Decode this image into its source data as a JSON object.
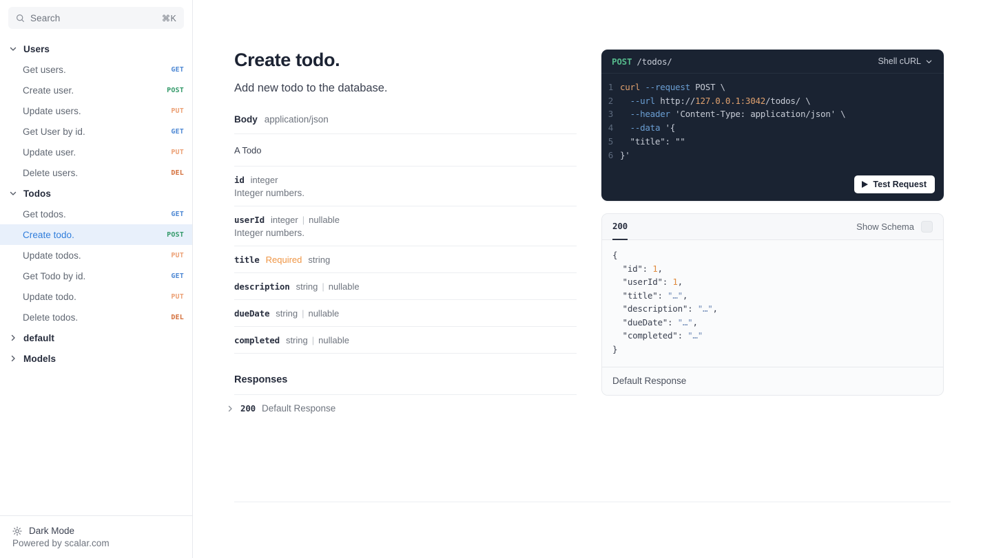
{
  "sidebar": {
    "search": {
      "placeholder": "Search",
      "shortcut": "⌘K",
      "icon": "search-icon"
    },
    "groups": [
      {
        "label": "Users",
        "expanded": true,
        "chevron": "chevron-down-icon",
        "items": [
          {
            "label": "Get users.",
            "method": "GET",
            "method_class": "m-get"
          },
          {
            "label": "Create user.",
            "method": "POST",
            "method_class": "m-post"
          },
          {
            "label": "Update users.",
            "method": "PUT",
            "method_class": "m-put"
          },
          {
            "label": "Get User by id.",
            "method": "GET",
            "method_class": "m-get"
          },
          {
            "label": "Update user.",
            "method": "PUT",
            "method_class": "m-put"
          },
          {
            "label": "Delete users.",
            "method": "DEL",
            "method_class": "m-del"
          }
        ]
      },
      {
        "label": "Todos",
        "expanded": true,
        "chevron": "chevron-down-icon",
        "items": [
          {
            "label": "Get todos.",
            "method": "GET",
            "method_class": "m-get",
            "active": false
          },
          {
            "label": "Create todo.",
            "method": "POST",
            "method_class": "m-post",
            "active": true
          },
          {
            "label": "Update todos.",
            "method": "PUT",
            "method_class": "m-put",
            "active": false
          },
          {
            "label": "Get Todo by id.",
            "method": "GET",
            "method_class": "m-get",
            "active": false
          },
          {
            "label": "Update todo.",
            "method": "PUT",
            "method_class": "m-put",
            "active": false
          },
          {
            "label": "Delete todos.",
            "method": "DEL",
            "method_class": "m-del",
            "active": false
          }
        ]
      },
      {
        "label": "default",
        "expanded": false,
        "chevron": "chevron-right-icon",
        "items": []
      },
      {
        "label": "Models",
        "expanded": false,
        "chevron": "chevron-right-icon",
        "items": []
      }
    ],
    "footer": {
      "dark_mode_label": "Dark Mode",
      "dark_mode_icon": "sun-icon",
      "powered_by": "Powered by scalar.com"
    }
  },
  "main": {
    "title": "Create todo.",
    "description": "Add new todo to the database.",
    "body": {
      "label": "Body",
      "mime": "application/json",
      "schema_title": "A Todo",
      "properties": [
        {
          "name": "id",
          "required": "",
          "type": "integer",
          "nullable": "",
          "description": "Integer numbers."
        },
        {
          "name": "userId",
          "required": "",
          "type": "integer",
          "nullable": "nullable",
          "description": "Integer numbers."
        },
        {
          "name": "title",
          "required": "Required",
          "type": "string",
          "nullable": "",
          "description": ""
        },
        {
          "name": "description",
          "required": "",
          "type": "string",
          "nullable": "nullable",
          "description": ""
        },
        {
          "name": "dueDate",
          "required": "",
          "type": "string",
          "nullable": "nullable",
          "description": ""
        },
        {
          "name": "completed",
          "required": "",
          "type": "string",
          "nullable": "nullable",
          "description": ""
        }
      ]
    },
    "responses": {
      "section_title": "Responses",
      "rows": [
        {
          "code": "200",
          "text": "Default Response",
          "chevron": "chevron-right-icon"
        }
      ]
    }
  },
  "code_panel": {
    "method": "POST",
    "path": "/todos/",
    "language": "Shell cURL",
    "language_chevron": "chevron-down-icon",
    "lines": [
      {
        "num": "1",
        "tokens": [
          {
            "t": "curl",
            "c": "t-fn"
          },
          {
            "t": " ",
            "c": "t-plain"
          },
          {
            "t": "--request",
            "c": "t-flag"
          },
          {
            "t": " POST \\",
            "c": "t-plain"
          }
        ]
      },
      {
        "num": "2",
        "tokens": [
          {
            "t": "  ",
            "c": "t-plain"
          },
          {
            "t": "--url",
            "c": "t-flag"
          },
          {
            "t": " http://",
            "c": "t-plain"
          },
          {
            "t": "127.0.0.1:3042",
            "c": "t-num"
          },
          {
            "t": "/todos/ \\",
            "c": "t-plain"
          }
        ]
      },
      {
        "num": "3",
        "tokens": [
          {
            "t": "  ",
            "c": "t-plain"
          },
          {
            "t": "--header",
            "c": "t-flag"
          },
          {
            "t": " 'Content-Type: application/json' \\",
            "c": "t-plain"
          }
        ]
      },
      {
        "num": "4",
        "tokens": [
          {
            "t": "  ",
            "c": "t-plain"
          },
          {
            "t": "--data",
            "c": "t-flag"
          },
          {
            "t": " '{",
            "c": "t-plain"
          }
        ]
      },
      {
        "num": "5",
        "tokens": [
          {
            "t": "  \"title\": \"\"",
            "c": "t-plain"
          }
        ]
      },
      {
        "num": "6",
        "tokens": [
          {
            "t": "}'",
            "c": "t-plain"
          }
        ]
      }
    ],
    "test_button": "Test Request",
    "play_icon": "play-icon"
  },
  "response_panel": {
    "status_tab": "200",
    "show_schema_label": "Show Schema",
    "toggle_icon": "schema-toggle",
    "lines": [
      [
        {
          "t": "{",
          "c": "j-punc"
        }
      ],
      [
        {
          "t": "  \"id\"",
          "c": "j-key"
        },
        {
          "t": ": ",
          "c": "j-punc"
        },
        {
          "t": "1",
          "c": "j-num"
        },
        {
          "t": ",",
          "c": "j-punc"
        }
      ],
      [
        {
          "t": "  \"userId\"",
          "c": "j-key"
        },
        {
          "t": ": ",
          "c": "j-punc"
        },
        {
          "t": "1",
          "c": "j-num"
        },
        {
          "t": ",",
          "c": "j-punc"
        }
      ],
      [
        {
          "t": "  \"title\"",
          "c": "j-key"
        },
        {
          "t": ": ",
          "c": "j-punc"
        },
        {
          "t": "\"…\"",
          "c": "j-str"
        },
        {
          "t": ",",
          "c": "j-punc"
        }
      ],
      [
        {
          "t": "  \"description\"",
          "c": "j-key"
        },
        {
          "t": ": ",
          "c": "j-punc"
        },
        {
          "t": "\"…\"",
          "c": "j-str"
        },
        {
          "t": ",",
          "c": "j-punc"
        }
      ],
      [
        {
          "t": "  \"dueDate\"",
          "c": "j-key"
        },
        {
          "t": ": ",
          "c": "j-punc"
        },
        {
          "t": "\"…\"",
          "c": "j-str"
        },
        {
          "t": ",",
          "c": "j-punc"
        }
      ],
      [
        {
          "t": "  \"completed\"",
          "c": "j-key"
        },
        {
          "t": ": ",
          "c": "j-punc"
        },
        {
          "t": "\"…\"",
          "c": "j-str"
        }
      ],
      [
        {
          "t": "}",
          "c": "j-punc"
        }
      ]
    ],
    "footer_text": "Default Response"
  },
  "colors": {
    "accent_active": "#2f7ddb",
    "active_bg": "#e8f0fb",
    "get": "#4f89d4",
    "post": "#349a6a",
    "put": "#eca176",
    "del": "#d4703c",
    "required": "#ef9544",
    "code_bg": "#1a2332"
  }
}
